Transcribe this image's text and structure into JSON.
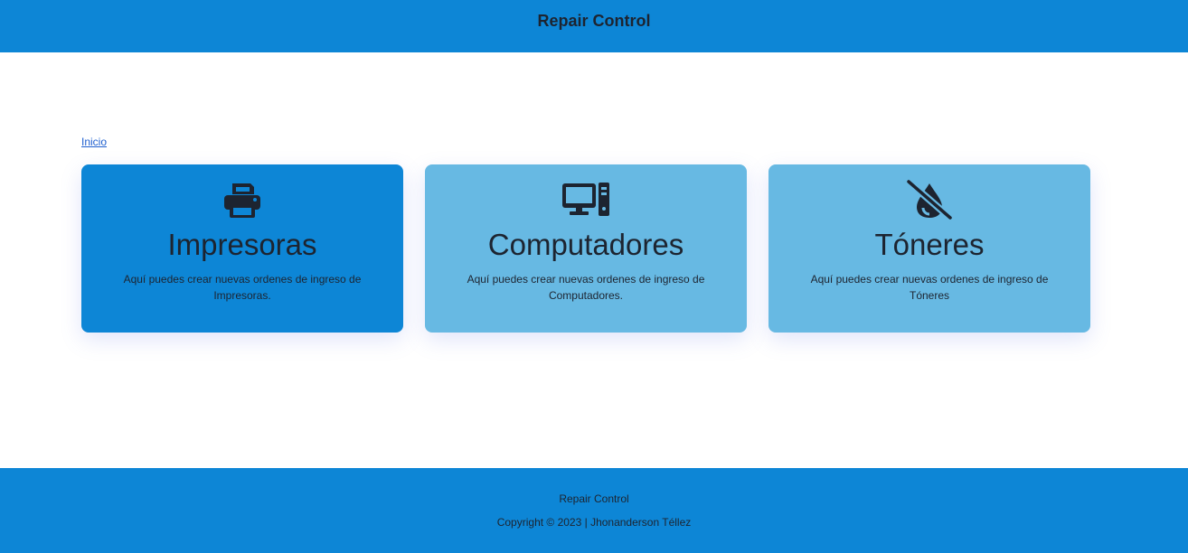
{
  "header": {
    "title": "Repair Control"
  },
  "breadcrumb": {
    "home": "Inicio"
  },
  "cards": [
    {
      "icon": "printer-icon",
      "title": "Impresoras",
      "description": "Aquí puedes crear nuevas ordenes de ingreso de Impresoras."
    },
    {
      "icon": "desktop-computer-icon",
      "title": "Computadores",
      "description": "Aquí puedes crear nuevas ordenes de ingreso de Computadores."
    },
    {
      "icon": "droplet-slash-icon",
      "title": "Tóneres",
      "description": "Aquí puedes crear nuevas ordenes de ingreso de Tóneres"
    }
  ],
  "footer": {
    "name": "Repair Control",
    "copyright": "Copyright © 2023 | Jhonanderson Téllez"
  },
  "colors": {
    "primary": "#0d86d6",
    "card_light": "#67b9e3",
    "text": "#1d2430",
    "link": "#1f5fcf"
  }
}
